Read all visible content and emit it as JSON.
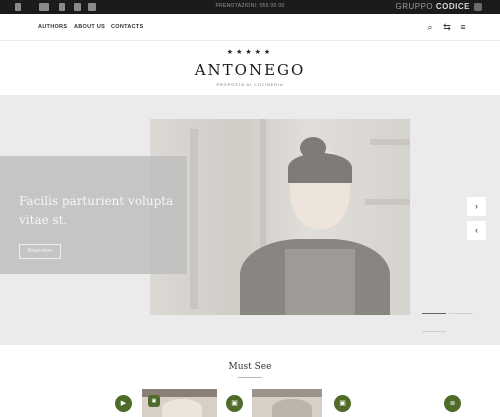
{
  "topbar": {
    "phone": "PRENOTAZIONI: 055 00 00",
    "brand_prefix": "GRUPPO",
    "brand_name": "CODICE",
    "icons": [
      "facebook-icon",
      "tripadvisor-icon",
      "location-icon",
      "instagram-icon",
      "gift-icon"
    ]
  },
  "nav": {
    "links": [
      "AUTHORS",
      "ABOUT US",
      "CONTACTS"
    ],
    "icons": [
      "search-icon",
      "share-icon",
      "menu-icon"
    ]
  },
  "logo": {
    "stars": "★★★★★",
    "name": "ANTONEGO",
    "tagline": "PROPOSTA DI COCINERIA"
  },
  "hero": {
    "title": "Facilis parturient volupta vitae st.",
    "cta": "Read more",
    "prev": "‹",
    "next": "›",
    "slides": 3,
    "active_slide": 0
  },
  "must_see": {
    "heading": "Must See",
    "badges": [
      "play-icon",
      "image-icon",
      "image-icon",
      "document-icon"
    ]
  },
  "colors": {
    "accent": "#4f6b2a",
    "topbar": "#1b1b1b"
  }
}
